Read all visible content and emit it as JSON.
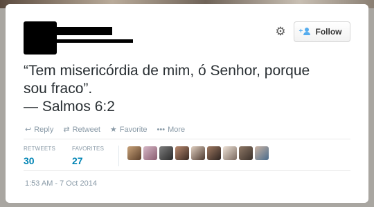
{
  "tweet": {
    "lines": [
      "“Tem misericórdia de mim, ó Senhor, porque",
      "sou fraco”.",
      "— Salmos 6:2"
    ],
    "timestamp": "1:53 AM - 7 Oct 2014"
  },
  "header": {
    "follow_label": "Follow",
    "gear_icon": "gear-icon",
    "follow_icon": "follow-user-icon"
  },
  "actions": [
    {
      "label": "Reply",
      "icon": "reply-icon"
    },
    {
      "label": "Retweet",
      "icon": "retweet-icon"
    },
    {
      "label": "Favorite",
      "icon": "star-icon"
    },
    {
      "label": "More",
      "icon": "more-dots-icon"
    }
  ],
  "stats": {
    "retweets_label": "RETWEETS",
    "retweets_count": "30",
    "favorites_label": "FAVORITES",
    "favorites_count": "27"
  },
  "colors": {
    "link": "#0084b4",
    "muted": "#8899a6",
    "accent": "#55acee"
  }
}
